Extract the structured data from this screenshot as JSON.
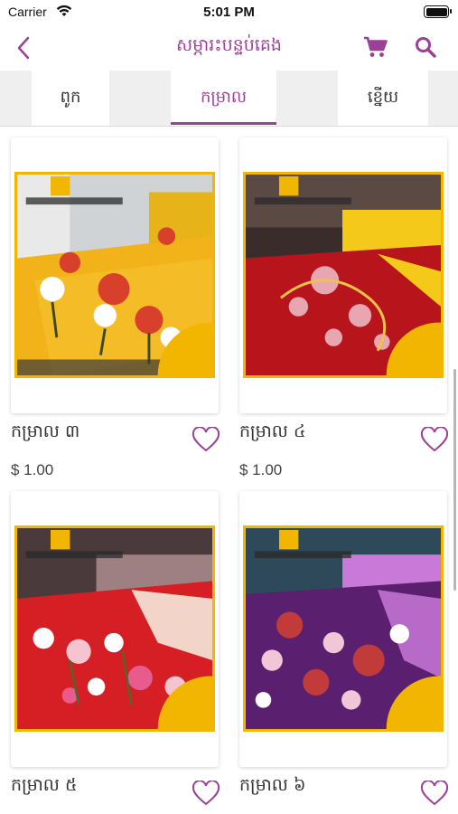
{
  "status_bar": {
    "carrier": "Carrier",
    "time": "5:01 PM"
  },
  "nav": {
    "title": "សម្ភារះបន្ទប់គេង"
  },
  "tabs": [
    {
      "label": "ពូក"
    },
    {
      "label": "កម្រាល",
      "selected": true
    },
    {
      "label": "ខ្នើយ"
    }
  ],
  "products": [
    {
      "name": "កម្រាល ៣",
      "price": "$ 1.00",
      "colors": {
        "primary": "#f2b21a",
        "secondary": "#d9402b"
      }
    },
    {
      "name": "កម្រាល ៤",
      "price": "$ 1.00",
      "colors": {
        "primary": "#b8141c",
        "secondary": "#f5c91a"
      }
    },
    {
      "name": "កម្រាល ៥",
      "price": "",
      "colors": {
        "primary": "#d51f24",
        "secondary": "#f2d4c8"
      }
    },
    {
      "name": "កម្រាល ៦",
      "price": "",
      "colors": {
        "primary": "#5a1f6e",
        "secondary": "#c23b3b"
      }
    }
  ],
  "brand": {
    "accent": "#9c3f98",
    "badge": "#f2b600"
  }
}
